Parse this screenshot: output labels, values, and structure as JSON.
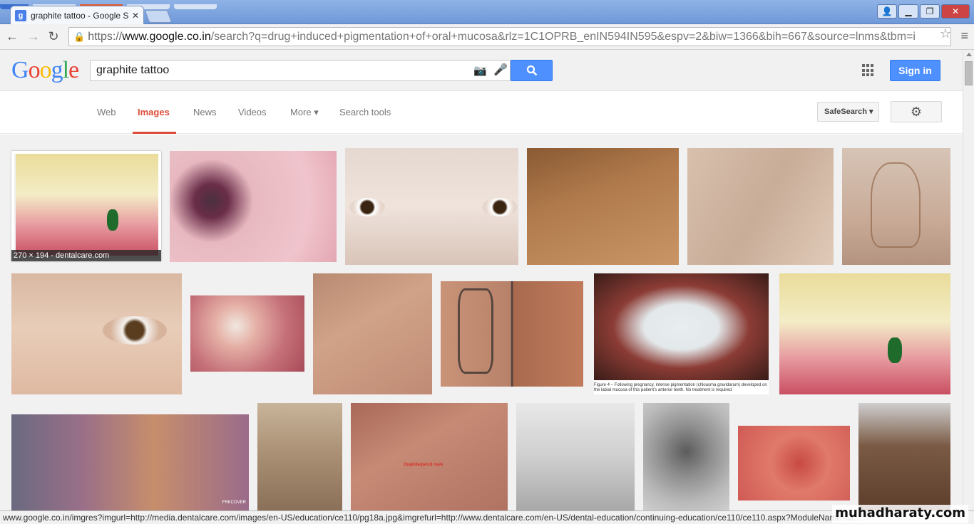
{
  "browser": {
    "tab_title": "graphite tattoo - Google S",
    "tab_favicon": "g",
    "url_scheme": "https://",
    "url_host": "www.google.co.in",
    "url_rest": "/search?q=drug+induced+pigmentation+of+oral+mucosa&rlz=1C1OPRB_enIN594IN595&espv=2&biw=1366&bih=667&source=lnms&tbm=i",
    "status_url": "www.google.co.in/imgres?imgurl=http://media.dentalcare.com/images/en-US/education/ce110/pg18a.jpg&imgrefurl=http://www.dentalcare.com/en-US/dental-education/continuing-education/ce110/ce110.aspx?ModuleName%3..."
  },
  "header": {
    "logo": "Google",
    "query": "graphite tattoo",
    "signin_label": "Sign in"
  },
  "nav": {
    "tabs": [
      {
        "label": "Web"
      },
      {
        "label": "Images"
      },
      {
        "label": "News"
      },
      {
        "label": "Videos"
      },
      {
        "label": "More ▾"
      },
      {
        "label": "Search tools"
      }
    ],
    "safesearch_label": "SafeSearch ▾"
  },
  "results": {
    "selected_caption": "270 × 194 - dentalcare.com",
    "figure_caption": "Figure 4 – Following pregnancy, intense pigmentation (chloasma gravidarum) developed on the labial mucosa of this patient's anterior teeth. No treatment is required.",
    "palm_annotation": "Graphite/pencil mark",
    "thumb_credit": "FRKCOVER"
  },
  "watermark": "muhadharaty.com",
  "colors": {
    "accent_red": "#dd4b39",
    "accent_blue": "#4d90fe"
  }
}
